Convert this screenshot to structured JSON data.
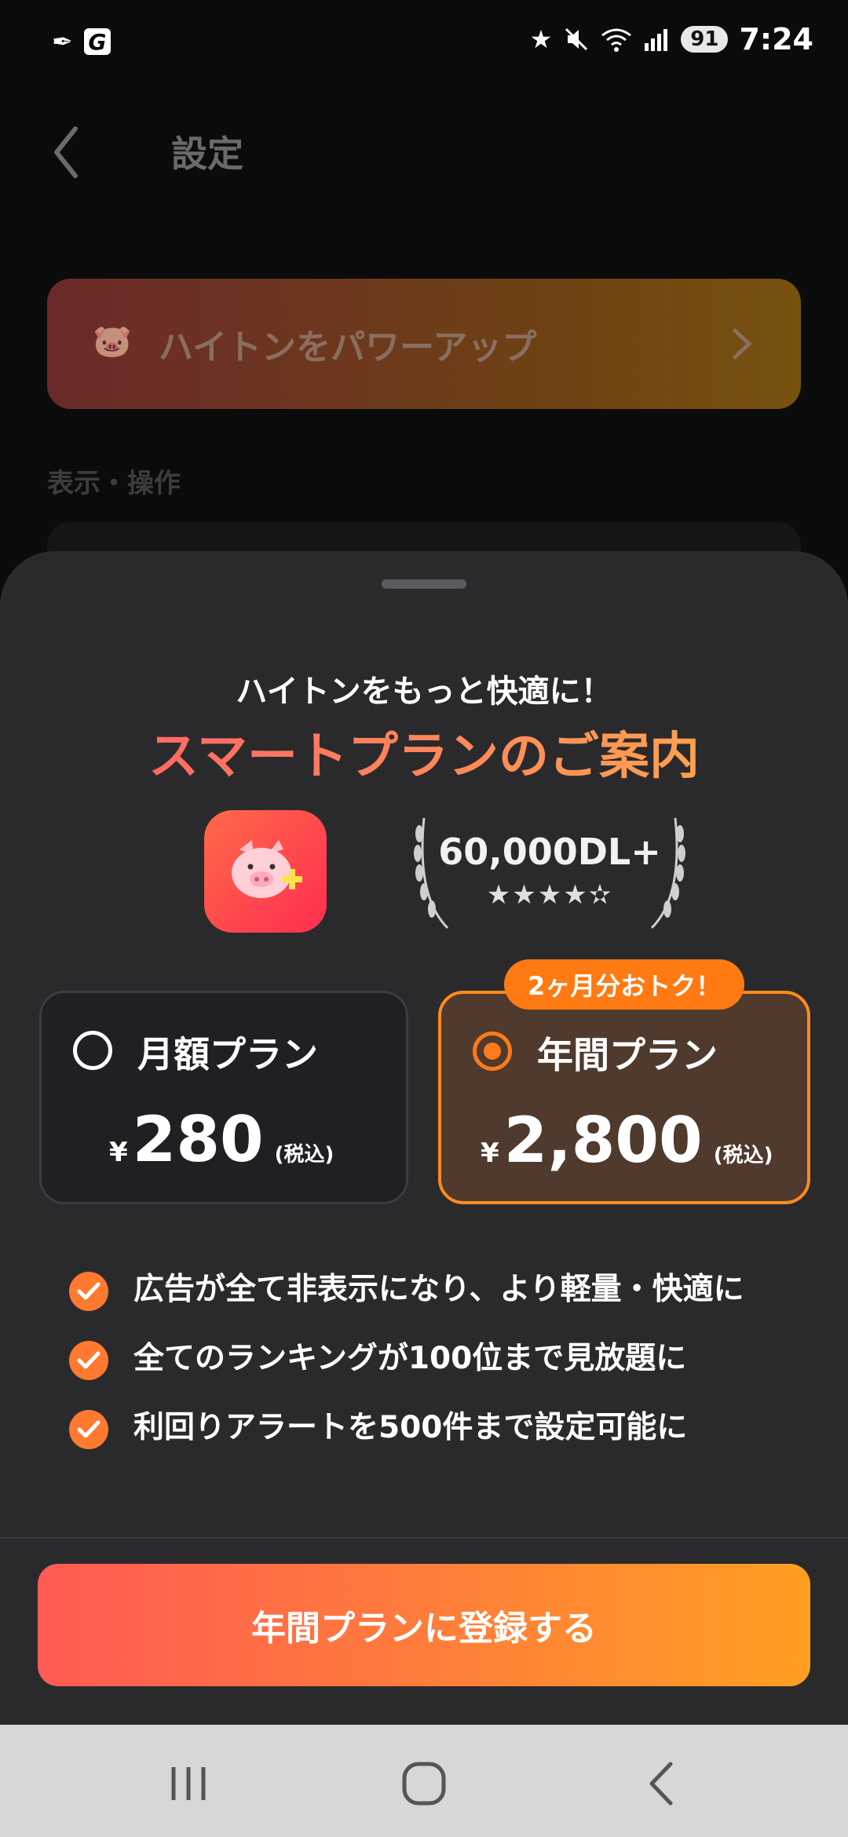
{
  "status_bar": {
    "app_icon_1": "feather-icon",
    "app_icon_2": "G",
    "icons": [
      "star-icon",
      "mute-icon",
      "wifi-icon",
      "signal-icon"
    ],
    "battery": "91",
    "time": "7:24"
  },
  "settings_page": {
    "title": "設定",
    "powerup_label": "ハイトンをパワーアップ",
    "section_display": "表示・操作"
  },
  "sheet": {
    "subtitle": "ハイトンをもっと快適に！",
    "title": "スマートプランのご案内",
    "downloads": "60,000DL+",
    "rating_stars": "★★★★✫",
    "badge": "2ヶ月分おトク！",
    "plans": [
      {
        "name": "月額プラン",
        "currency": "¥",
        "price": "280",
        "tax": "(税込)",
        "selected": false
      },
      {
        "name": "年間プラン",
        "currency": "¥",
        "price": "2,800",
        "tax": "(税込)",
        "selected": true
      }
    ],
    "features": [
      "広告が全て非表示になり、より軽量・快適に",
      "全てのランキングが100位まで見放題に",
      "利回りアラートを500件まで設定可能に"
    ],
    "cta": "年間プランに登録する"
  },
  "colors": {
    "accent": "#ff7a1a",
    "cta_start": "#ff5a54",
    "cta_end": "#ff9f22"
  }
}
